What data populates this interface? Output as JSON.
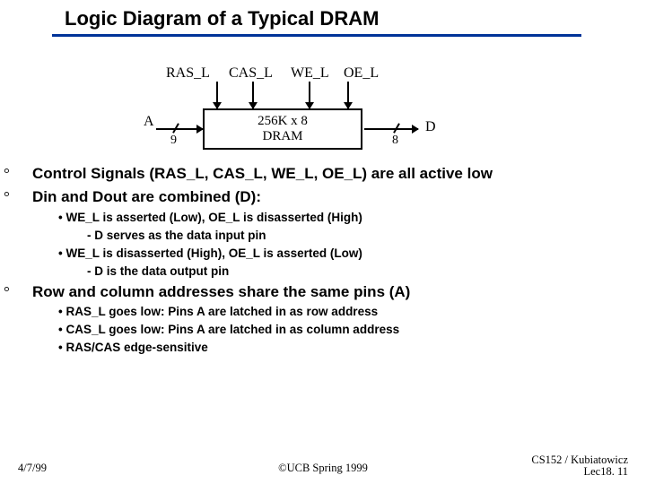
{
  "title": "Logic Diagram of a Typical DRAM",
  "signals": {
    "ras": "RAS_L",
    "cas": "CAS_L",
    "we": "WE_L",
    "oe": "OE_L",
    "a": "A",
    "a_width": "9",
    "d": "D",
    "d_width": "8"
  },
  "dram": {
    "line1": "256K x 8",
    "line2": "DRAM"
  },
  "bullets": {
    "b1": "Control Signals (RAS_L, CAS_L, WE_L, OE_L) are all active low",
    "b2": "Din and Dout are combined (D):",
    "b2_sub": [
      "WE_L is asserted (Low), OE_L is disasserted (High)",
      "D serves as the data input pin",
      "WE_L is disasserted (High), OE_L is asserted (Low)",
      "D is the data output pin"
    ],
    "b3": "Row and column addresses share the same pins (A)",
    "b3_sub": [
      "RAS_L goes low: Pins A are latched in as row address",
      "CAS_L goes low: Pins A are latched in as column address",
      "RAS/CAS edge-sensitive"
    ]
  },
  "footer": {
    "left": "4/7/99",
    "center": "©UCB Spring 1999",
    "right1": "CS152 / Kubiatowicz",
    "right2": "Lec18. 11"
  }
}
